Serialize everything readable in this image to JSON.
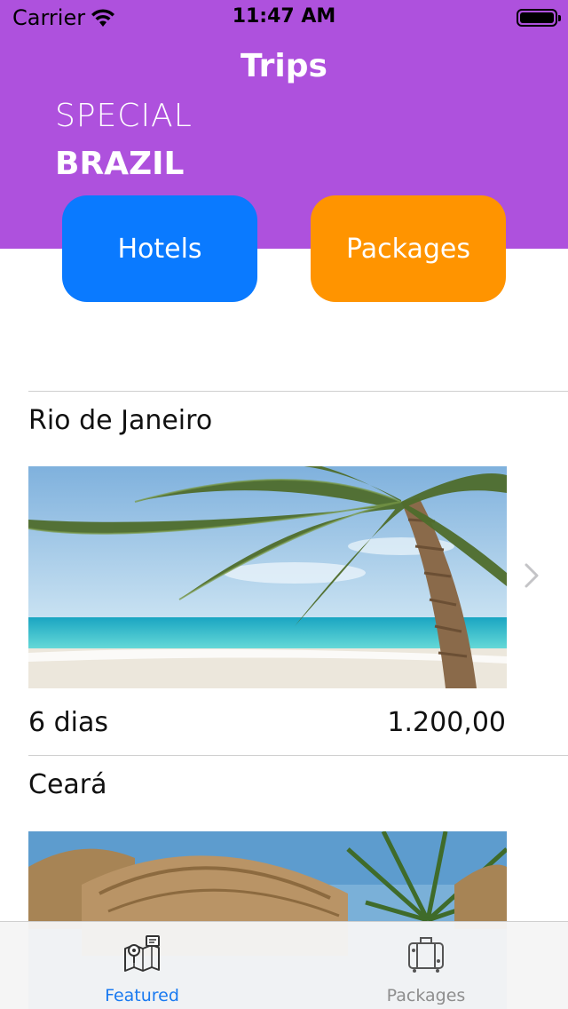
{
  "status_bar": {
    "carrier": "Carrier",
    "time": "11:47 AM"
  },
  "nav": {
    "title": "Trips"
  },
  "banner": {
    "line1": "SPECIAL",
    "line2": "BRAZIL"
  },
  "buttons": {
    "hotels": "Hotels",
    "packages": "Packages"
  },
  "trips": [
    {
      "name": "Rio de Janeiro",
      "duration": "6 dias",
      "price": "1.200,00"
    },
    {
      "name": "Ceará"
    }
  ],
  "tabs": [
    {
      "label": "Featured",
      "icon": "map-icon",
      "selected": true
    },
    {
      "label": "Packages",
      "icon": "suitcase-icon",
      "selected": false
    }
  ],
  "colors": {
    "header_bg": "#AE51DD",
    "hotels_bg": "#0A7AFF",
    "packages_bg": "#FF9400",
    "tab_active": "#1A7AF0",
    "tab_inactive": "#8E8E8E"
  }
}
